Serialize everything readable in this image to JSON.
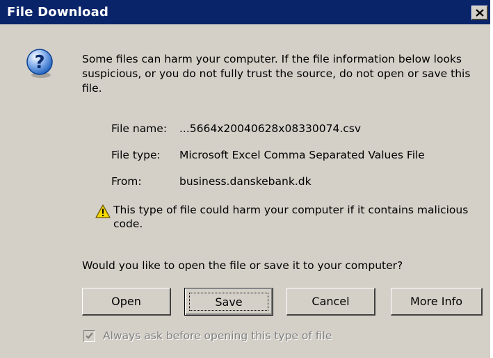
{
  "window": {
    "title": "File Download",
    "close_glyph": "✕"
  },
  "message": "Some files can harm your computer. If the file information below looks suspicious, or you do not fully trust the source, do not open or save this file.",
  "file_info": {
    "name_label": "File name:",
    "name_value": "...5664x20040628x08330074.csv",
    "type_label": "File type:",
    "type_value": "Microsoft Excel Comma Separated Values File",
    "from_label": "From:",
    "from_value": "business.danskebank.dk"
  },
  "warning": "This type of file could harm your computer if it contains malicious code.",
  "question": "Would you like to open the file or save it to your computer?",
  "buttons": {
    "open": "Open",
    "save": "Save",
    "cancel": "Cancel",
    "more_info": "More Info"
  },
  "checkbox": {
    "label": "Always ask before opening this type of file",
    "checked": true,
    "disabled": true
  },
  "icons": {
    "question": "question-icon",
    "warning": "warning-icon",
    "close": "close-icon"
  },
  "colors": {
    "titlebar": "#0a246a",
    "dialog_bg": "#d4d0c8",
    "question_icon": "#1c5fbd",
    "warning_icon": "#f5d800"
  }
}
